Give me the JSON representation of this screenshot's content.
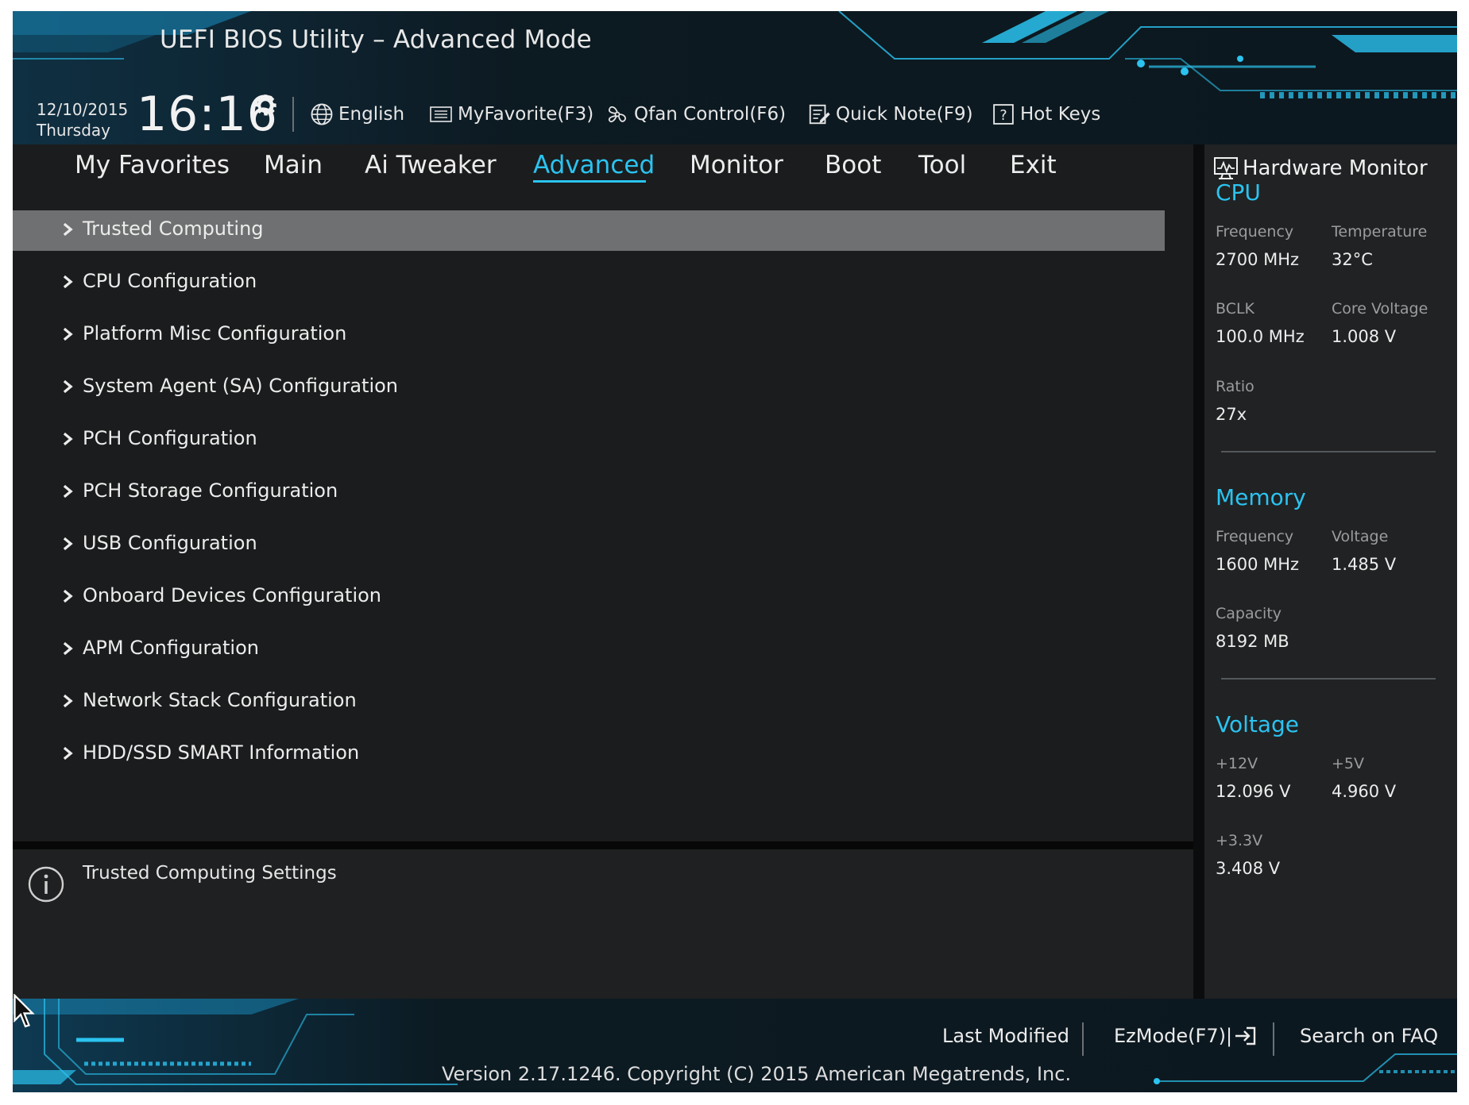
{
  "header": {
    "title": "UEFI BIOS Utility – Advanced Mode",
    "date": "12/10/2015",
    "day": "Thursday",
    "time": "16:16",
    "toolbar": {
      "language": "English",
      "myfavorite": "MyFavorite(F3)",
      "qfan": "Qfan Control(F6)",
      "quicknote": "Quick Note(F9)",
      "hotkeys": "Hot Keys"
    }
  },
  "nav": {
    "tabs": [
      "My Favorites",
      "Main",
      "Ai Tweaker",
      "Advanced",
      "Monitor",
      "Boot",
      "Tool",
      "Exit"
    ],
    "active_tab": "Advanced"
  },
  "menu": {
    "items": [
      "Trusted Computing",
      "CPU Configuration",
      "Platform Misc Configuration",
      "System Agent (SA) Configuration",
      "PCH Configuration",
      "PCH Storage Configuration",
      "USB Configuration",
      "Onboard Devices Configuration",
      "APM Configuration",
      "Network Stack Configuration",
      "HDD/SSD SMART Information"
    ],
    "selected": "Trusted Computing"
  },
  "help": {
    "text": "Trusted Computing Settings"
  },
  "hardware_monitor": {
    "title": "Hardware Monitor",
    "cpu": {
      "heading": "CPU",
      "frequency_label": "Frequency",
      "frequency": "2700 MHz",
      "temperature_label": "Temperature",
      "temperature": "32°C",
      "bclk_label": "BCLK",
      "bclk": "100.0 MHz",
      "core_voltage_label": "Core Voltage",
      "core_voltage": "1.008 V",
      "ratio_label": "Ratio",
      "ratio": "27x"
    },
    "memory": {
      "heading": "Memory",
      "frequency_label": "Frequency",
      "frequency": "1600 MHz",
      "voltage_label": "Voltage",
      "voltage": "1.485 V",
      "capacity_label": "Capacity",
      "capacity": "8192 MB"
    },
    "voltage": {
      "heading": "Voltage",
      "v12_label": "+12V",
      "v12": "12.096 V",
      "v5_label": "+5V",
      "v5": "4.960 V",
      "v33_label": "+3.3V",
      "v33": "3.408 V"
    }
  },
  "footer": {
    "last_modified": "Last Modified",
    "ezmode": "EzMode(F7)|",
    "search_faq": "Search on FAQ",
    "copyright": "Version 2.17.1246. Copyright (C) 2015 American Megatrends, Inc."
  },
  "colors": {
    "accent": "#2bc3f0",
    "background": "#1b1c1d",
    "selected_row": "#6f7071",
    "panel": "#202223"
  }
}
